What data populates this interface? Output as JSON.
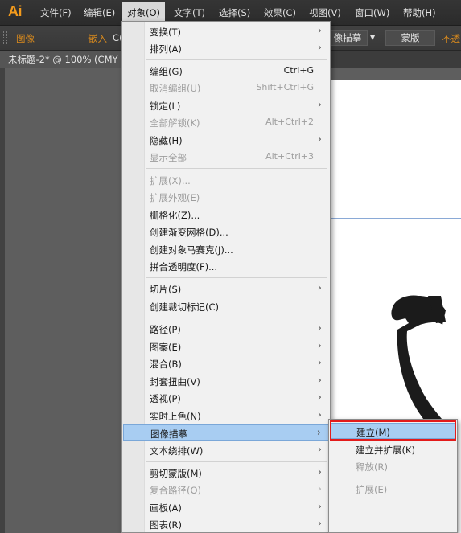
{
  "app": {
    "logo": "Ai"
  },
  "menubar": {
    "items": [
      {
        "label": "文件(F)"
      },
      {
        "label": "编辑(E)"
      },
      {
        "label": "对象(O)"
      },
      {
        "label": "文字(T)"
      },
      {
        "label": "选择(S)"
      },
      {
        "label": "效果(C)"
      },
      {
        "label": "视图(V)"
      },
      {
        "label": "窗口(W)"
      },
      {
        "label": "帮助(H)"
      }
    ]
  },
  "controlbar": {
    "image_label": "图像",
    "embed_label": "嵌入",
    "cut_text": "C(",
    "trace_button": "像描摹",
    "mask_button": "蒙版",
    "opacity_label": "不透"
  },
  "document": {
    "tab_title": "未标题-2* @ 100% (CMY",
    "close": "✕"
  },
  "object_menu": {
    "items": [
      {
        "label": "变换(T)",
        "shortcut": "",
        "arrow": "›"
      },
      {
        "label": "排列(A)",
        "shortcut": "",
        "arrow": "›"
      },
      {
        "label": "编组(G)",
        "shortcut": "Ctrl+G",
        "arrow": ""
      },
      {
        "label": "取消编组(U)",
        "shortcut": "Shift+Ctrl+G",
        "arrow": ""
      },
      {
        "label": "锁定(L)",
        "shortcut": "",
        "arrow": "›"
      },
      {
        "label": "全部解锁(K)",
        "shortcut": "Alt+Ctrl+2",
        "arrow": ""
      },
      {
        "label": "隐藏(H)",
        "shortcut": "",
        "arrow": "›"
      },
      {
        "label": "显示全部",
        "shortcut": "Alt+Ctrl+3",
        "arrow": ""
      },
      {
        "label": "扩展(X)...",
        "shortcut": "",
        "arrow": ""
      },
      {
        "label": "扩展外观(E)",
        "shortcut": "",
        "arrow": ""
      },
      {
        "label": "栅格化(Z)...",
        "shortcut": "",
        "arrow": ""
      },
      {
        "label": "创建渐变网格(D)...",
        "shortcut": "",
        "arrow": ""
      },
      {
        "label": "创建对象马赛克(J)...",
        "shortcut": "",
        "arrow": ""
      },
      {
        "label": "拼合透明度(F)...",
        "shortcut": "",
        "arrow": ""
      },
      {
        "label": "切片(S)",
        "shortcut": "",
        "arrow": "›"
      },
      {
        "label": "创建裁切标记(C)",
        "shortcut": "",
        "arrow": ""
      },
      {
        "label": "路径(P)",
        "shortcut": "",
        "arrow": "›"
      },
      {
        "label": "图案(E)",
        "shortcut": "",
        "arrow": "›"
      },
      {
        "label": "混合(B)",
        "shortcut": "",
        "arrow": "›"
      },
      {
        "label": "封套扭曲(V)",
        "shortcut": "",
        "arrow": "›"
      },
      {
        "label": "透视(P)",
        "shortcut": "",
        "arrow": "›"
      },
      {
        "label": "实时上色(N)",
        "shortcut": "",
        "arrow": "›"
      },
      {
        "label": "图像描摹",
        "shortcut": "",
        "arrow": "›"
      },
      {
        "label": "文本绕排(W)",
        "shortcut": "",
        "arrow": "›"
      },
      {
        "label": "剪切蒙版(M)",
        "shortcut": "",
        "arrow": "›"
      },
      {
        "label": "复合路径(O)",
        "shortcut": "",
        "arrow": "›"
      },
      {
        "label": "画板(A)",
        "shortcut": "",
        "arrow": "›"
      },
      {
        "label": "图表(R)",
        "shortcut": "",
        "arrow": "›"
      }
    ]
  },
  "trace_submenu": {
    "items": [
      {
        "label": "建立(M)"
      },
      {
        "label": "建立并扩展(K)"
      },
      {
        "label": "释放(R)"
      },
      {
        "label": "扩展(E)"
      }
    ]
  }
}
